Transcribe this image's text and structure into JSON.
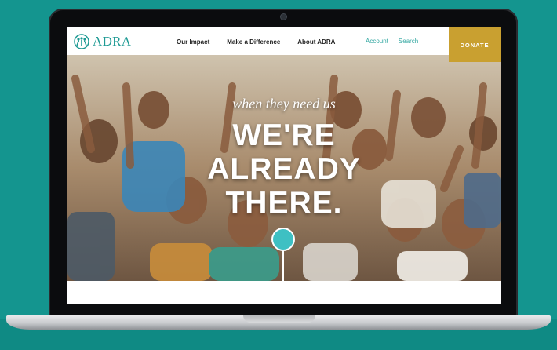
{
  "site": {
    "logo_text": "ADRA",
    "nav": [
      "Our Impact",
      "Make a Difference",
      "About ADRA"
    ],
    "utility": [
      "Account",
      "Search"
    ],
    "donate_label": "DONATE"
  },
  "hero": {
    "tagline": "when they need us",
    "headline_lines": [
      "WE'RE",
      "ALREADY",
      "THERE."
    ]
  },
  "colors": {
    "background": "#14958f",
    "brand_teal": "#1e9a94",
    "donate": "#c9a030"
  },
  "icons": [
    "adra-logo-icon",
    "globe-icon",
    "camera-icon"
  ]
}
